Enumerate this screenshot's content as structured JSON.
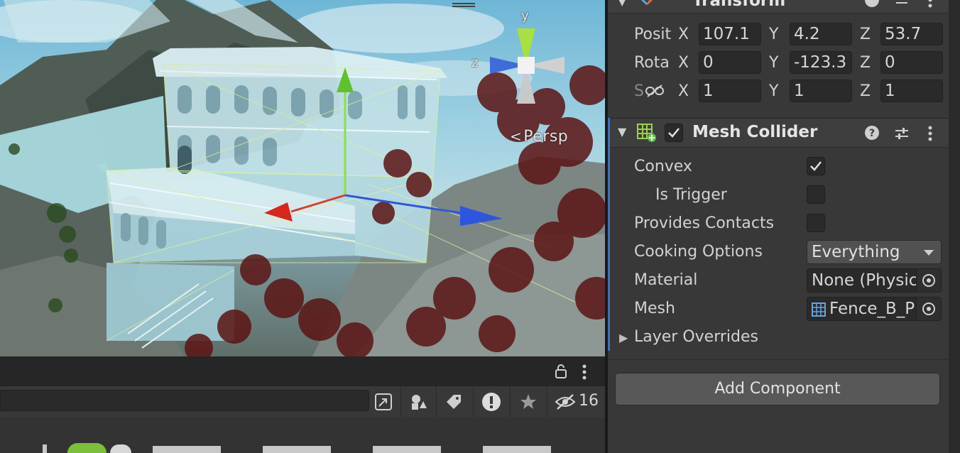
{
  "scene": {
    "persp_label": "Persp",
    "gizmo_axes": {
      "y": "y",
      "z": "z"
    }
  },
  "inspector": {
    "transform": {
      "title": "Transform",
      "position_label": "Posit",
      "rotation_label": "Rota",
      "scale_label": "S",
      "position": {
        "x": "107.1",
        "y": "4.2",
        "z": "53.7"
      },
      "rotation": {
        "x": "0",
        "y": "-123.3",
        "z": "0"
      },
      "scale": {
        "x": "1",
        "y": "1",
        "z": "1"
      },
      "axis_x": "X",
      "axis_y": "Y",
      "axis_z": "Z"
    },
    "mesh_collider": {
      "title": "Mesh Collider",
      "enabled": true,
      "convex_label": "Convex",
      "convex": true,
      "is_trigger_label": "Is Trigger",
      "is_trigger": false,
      "provides_contacts_label": "Provides Contacts",
      "provides_contacts": false,
      "cooking_options_label": "Cooking Options",
      "cooking_options_value": "Everything",
      "material_label": "Material",
      "material_value": "None (Physic",
      "mesh_label": "Mesh",
      "mesh_value": "Fence_B_P",
      "layer_overrides_label": "Layer Overrides"
    },
    "add_component_label": "Add Component"
  },
  "project": {
    "search_placeholder": "",
    "hidden_count": "16"
  },
  "colors": {
    "inspector_bg": "#383838",
    "accent_blue": "#3d72b8",
    "gizmo_x": "#e03a2a",
    "gizmo_y": "#7ed63a",
    "gizmo_z": "#2f55e0"
  }
}
